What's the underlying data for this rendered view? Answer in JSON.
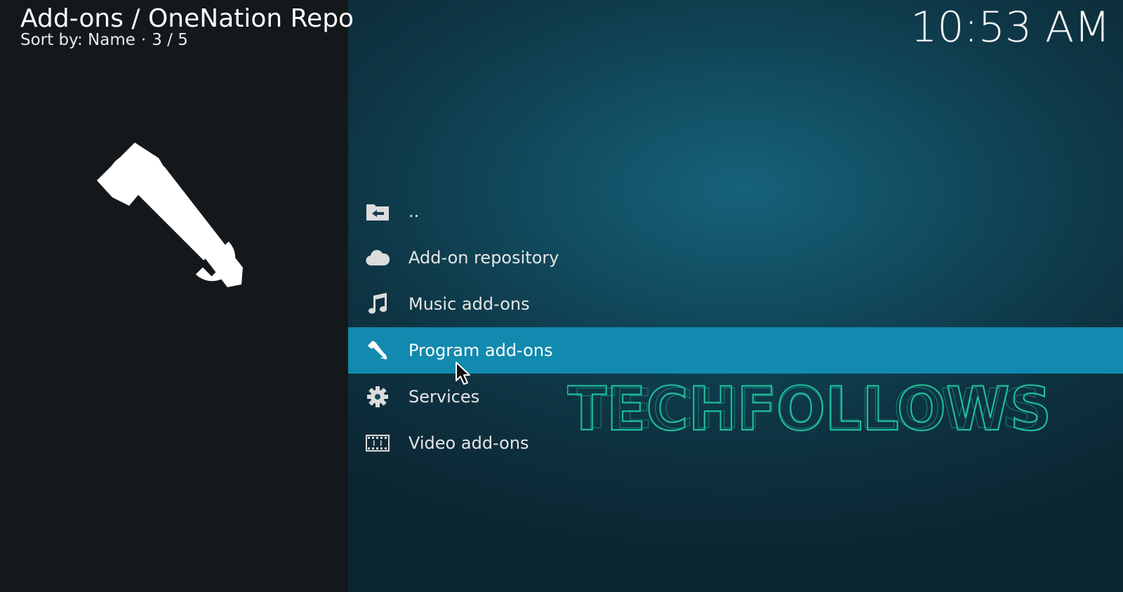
{
  "header": {
    "title": "Add-ons / OneNation Repo",
    "sort_label": "Sort by: Name",
    "separator": "·",
    "position": "3 / 5"
  },
  "clock": "10:53 AM",
  "category_icon": "hammer-wrench-icon",
  "list": {
    "items": [
      {
        "label": "..",
        "icon": "folder-back-icon",
        "selected": false
      },
      {
        "label": "Add-on repository",
        "icon": "cloud-icon",
        "selected": false
      },
      {
        "label": "Music add-ons",
        "icon": "music-note-icon",
        "selected": false
      },
      {
        "label": "Program add-ons",
        "icon": "tools-icon",
        "selected": true
      },
      {
        "label": "Services",
        "icon": "gear-icon",
        "selected": false
      },
      {
        "label": "Video add-ons",
        "icon": "film-strip-icon",
        "selected": false
      }
    ]
  },
  "watermark": "TECHFOLLOWS",
  "colors": {
    "selection": "#1289ae",
    "watermark": "#1fbf9a",
    "left_panel": "#14181b"
  }
}
